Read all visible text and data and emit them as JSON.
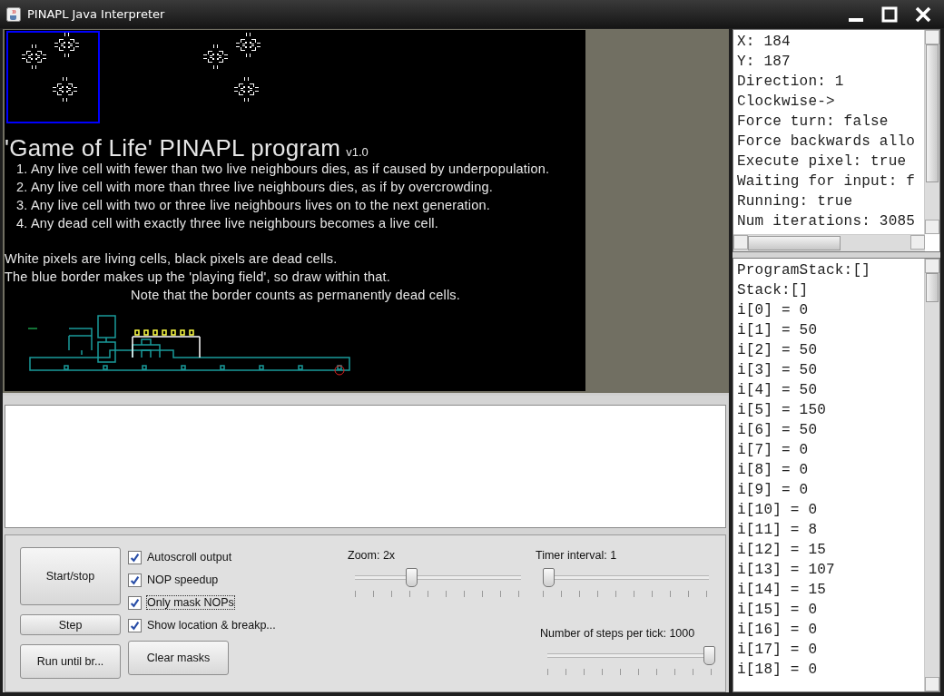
{
  "window": {
    "title": "PINAPL Java Interpreter"
  },
  "canvas": {
    "title": "'Game of Life' PINAPL program",
    "version": "v1.0",
    "rules": [
      "1. Any live cell with fewer than two live neighbours dies, as if caused by underpopulation.",
      "2. Any live cell with more than three live neighbours dies, as if by overcrowding.",
      "3. Any live cell with two or three live neighbours lives on to the next generation.",
      "4. Any dead cell with exactly three live neighbours becomes a live cell."
    ],
    "notes": [
      {
        "text": "White pixels are living cells, black pixels are dead cells.",
        "indented": false
      },
      {
        "text": "The blue border makes up the 'playing field', so draw within that.",
        "indented": false
      },
      {
        "text": "Note that the border counts as permanently dead cells.",
        "indented": true
      }
    ]
  },
  "controls": {
    "buttons": [
      {
        "label": "Start/stop",
        "kind": "large"
      },
      {
        "label": "Step",
        "kind": "small"
      },
      {
        "label": "Run until br...",
        "kind": "medium"
      },
      {
        "label": "Clear masks",
        "kind": "medium"
      }
    ],
    "checkboxes": [
      {
        "label": "Autoscroll output",
        "checked": true,
        "focused": false
      },
      {
        "label": "NOP speedup",
        "checked": true,
        "focused": false
      },
      {
        "label": "Only mask NOPs",
        "checked": true,
        "focused": true
      },
      {
        "label": "Show location & breakp...",
        "checked": true,
        "focused": false
      }
    ],
    "sliders": [
      {
        "label": "Zoom: 2x",
        "level": 0.34
      },
      {
        "label": "Timer interval: 1",
        "level": 0.03
      },
      {
        "label": "Number of steps per tick: 1000",
        "level": 0.97
      }
    ]
  },
  "info_lines": [
    "X: 184",
    "Y: 187",
    "Direction: 1",
    "Clockwise->",
    "Force turn: false",
    "Force backwards allo",
    "Execute pixel: true",
    "Waiting for input: f",
    "Running: true",
    "Num iterations: 3085"
  ],
  "stack_lines": [
    "ProgramStack:[]",
    "Stack:[]",
    "i[0] = 0",
    "i[1] = 50",
    "i[2] = 50",
    "i[3] = 50",
    "i[4] = 50",
    "i[5] = 150",
    "i[6] = 50",
    "i[7] = 0",
    "i[8] = 0",
    "i[9] = 0",
    "i[10] = 0",
    "i[11] = 8",
    "i[12] = 15",
    "i[13] = 107",
    "i[14] = 15",
    "i[15] = 0",
    "i[16] = 0",
    "i[17] = 0",
    "i[18] = 0"
  ]
}
